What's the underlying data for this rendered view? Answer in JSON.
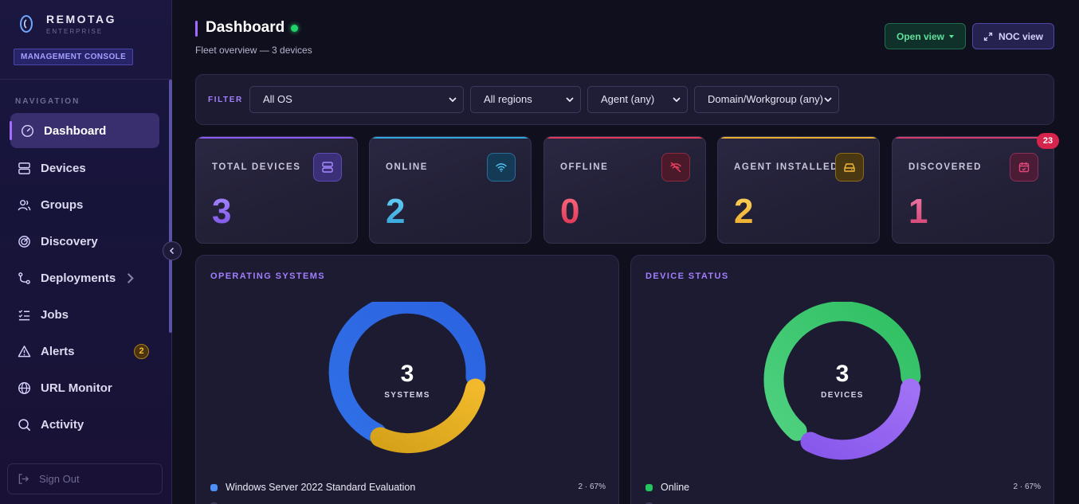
{
  "brand": {
    "name": "REMOTAG",
    "sub": "ENTERPRISE",
    "badge": "MANAGEMENT CONSOLE"
  },
  "nav": {
    "title": "NAVIGATION",
    "items": [
      {
        "label": "Dashboard",
        "icon": "gauge-icon",
        "active": true
      },
      {
        "label": "Devices",
        "icon": "server-icon"
      },
      {
        "label": "Groups",
        "icon": "users-icon"
      },
      {
        "label": "Discovery",
        "icon": "radar-icon"
      },
      {
        "label": "Deployments",
        "icon": "git-branch-icon"
      },
      {
        "label": "Jobs",
        "icon": "checklist-icon"
      },
      {
        "label": "Alerts",
        "icon": "warning-icon",
        "badge": "2"
      },
      {
        "label": "URL Monitor",
        "icon": "globe-icon"
      },
      {
        "label": "Activity",
        "icon": "search-icon"
      }
    ],
    "sign_out": "Sign Out"
  },
  "header": {
    "title": "Dashboard",
    "subtitle": "Fleet overview — 3 devices",
    "open_view": "Open view",
    "noc_view": "NOC view"
  },
  "filter": {
    "label": "FILTER",
    "os": "All OS",
    "region": "All regions",
    "agent": "Agent (any)",
    "domain": "Domain/Workgroup (any)"
  },
  "stats": [
    {
      "label": "TOTAL DEVICES",
      "value": "3",
      "color": "#9b6bff",
      "icon": "server-icon"
    },
    {
      "label": "ONLINE",
      "value": "2",
      "color": "#3fb6e8",
      "icon": "wifi-icon"
    },
    {
      "label": "OFFLINE",
      "value": "0",
      "color": "#e9405c",
      "icon": "wifi-off-icon"
    },
    {
      "label": "AGENT INSTALLED",
      "value": "2",
      "color": "#f2b93b",
      "icon": "hard-drive-icon"
    },
    {
      "label": "DISCOVERED",
      "value": "1",
      "color": "#e2497a",
      "icon": "calendar-check-icon",
      "badge": "23"
    }
  ],
  "os_panel": {
    "title": "OPERATING SYSTEMS",
    "total": "3",
    "caption": "SYSTEMS",
    "legend": [
      {
        "label": "Windows Server 2022 Standard Evaluation",
        "value": "2 · 67%",
        "color": "#4d8ef7"
      }
    ]
  },
  "status_panel": {
    "title": "DEVICE STATUS",
    "total": "3",
    "caption": "DEVICES",
    "legend": [
      {
        "label": "Online",
        "value": "2 · 67%",
        "color": "#22c55e"
      }
    ]
  },
  "colors": {
    "accent": "#a36bff",
    "online": "#22d36b"
  }
}
